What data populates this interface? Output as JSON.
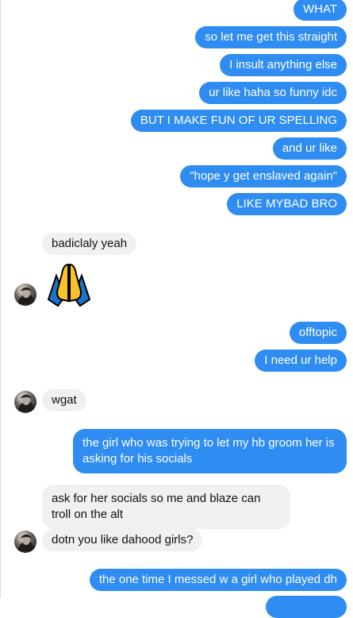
{
  "messages": [
    {
      "text": "WHAT"
    },
    {
      "text": "so let me get this straight"
    },
    {
      "text": "I insult anything else"
    },
    {
      "text": "ur like haha so funny idc"
    },
    {
      "text": "BUT I MAKE FUN OF UR SPELLING"
    },
    {
      "text": "and ur like"
    },
    {
      "text": "\"hope y get enslaved again\""
    },
    {
      "text": "LIKE MYBAD BRO"
    },
    {
      "text": "badiclaly yeah"
    },
    {
      "emoji": "folded-hands"
    },
    {
      "text": "offtopic"
    },
    {
      "text": "I need ur help"
    },
    {
      "text": "wgat"
    },
    {
      "text": "the girl who was trying to let my hb groom her is asking for his socials"
    },
    {
      "text": "ask for her socials so me and blaze can troll on the alt"
    },
    {
      "text": "dotn you like dahood girls?"
    },
    {
      "text": "the one time I messed w a girl who played dh"
    }
  ],
  "colors": {
    "outgoing_bubble": "#2f8cf0",
    "incoming_bubble": "#f0f0f0",
    "outgoing_text": "#ffffff",
    "incoming_text": "#111111"
  }
}
